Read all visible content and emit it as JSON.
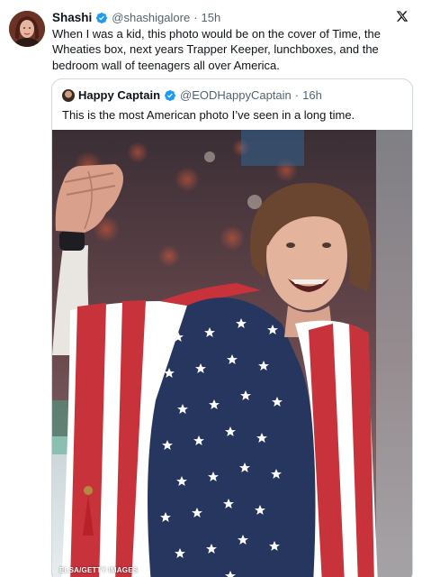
{
  "tweet": {
    "author_name": "Shashi",
    "author_handle": "@shashigalore",
    "separator": "·",
    "time": "15h",
    "text": "When I was a kid, this photo would be on the cover of Time, the Wheaties box, next years Trapper Keeper, lunchboxes, and the bedroom wall of teenagers all over America."
  },
  "quoted": {
    "author_name": "Happy Captain",
    "author_handle": "@EODHappyCaptain",
    "separator": "·",
    "time": "16h",
    "text": "This is the most American photo I’ve seen in a long time.",
    "photo_credit": "ELSA/GETTY IMAGES"
  },
  "icons": {
    "verified": "verified-badge-icon",
    "x_logo": "x-logo-icon"
  },
  "colors": {
    "verified_blue": "#1d9bf0",
    "secondary_text": "#536471",
    "border": "#cfd9de"
  }
}
